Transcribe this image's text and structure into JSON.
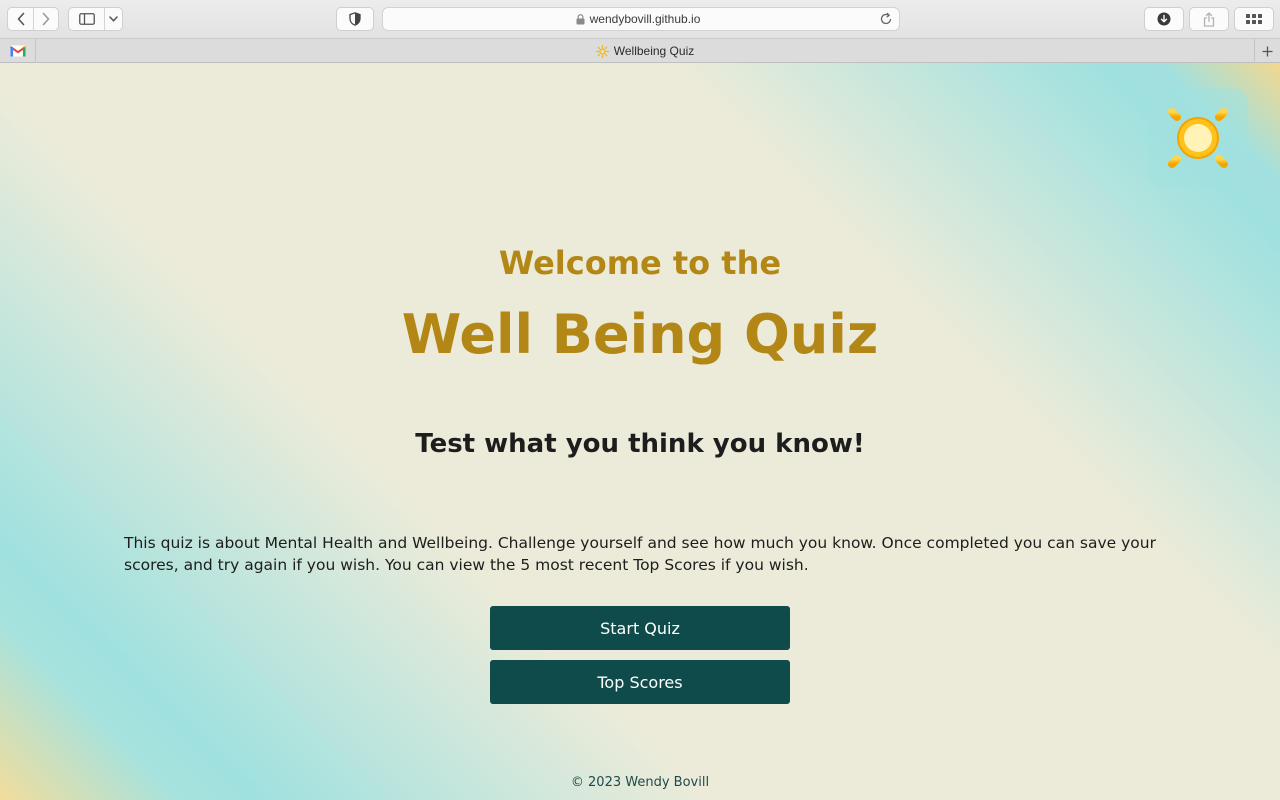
{
  "browser": {
    "url": "wendybovill.github.io",
    "tab_title": "Wellbeing Quiz"
  },
  "icons": {
    "back": "chevron-left-icon",
    "forward": "chevron-right-icon",
    "sidebar": "sidebar-icon",
    "privacy": "shield-icon",
    "lock": "lock-icon",
    "reload": "reload-icon",
    "download": "download-icon",
    "share": "share-icon",
    "tab_overview": "grid-icon",
    "pinned_tab": "gmail-icon",
    "new_tab": "plus-icon",
    "page_logo": "sun-icon"
  },
  "colors": {
    "heading": "#b38716",
    "button_bg": "#104b4c",
    "button_text": "#ffffff",
    "page_bg": "#ecebd9",
    "accent_teal": "#9fe1df"
  },
  "hero": {
    "welcome": "Welcome to the",
    "title": "Well Being Quiz",
    "tagline": "Test what you think you know!"
  },
  "intro": "This quiz is about Mental Health and Wellbeing. Challenge yourself and see how much you know. Once completed you can save your scores, and try again if you wish. You can view the 5 most recent Top Scores if you wish.",
  "buttons": {
    "start": "Start Quiz",
    "top_scores": "Top Scores"
  },
  "footer": "© 2023 Wendy Bovill"
}
